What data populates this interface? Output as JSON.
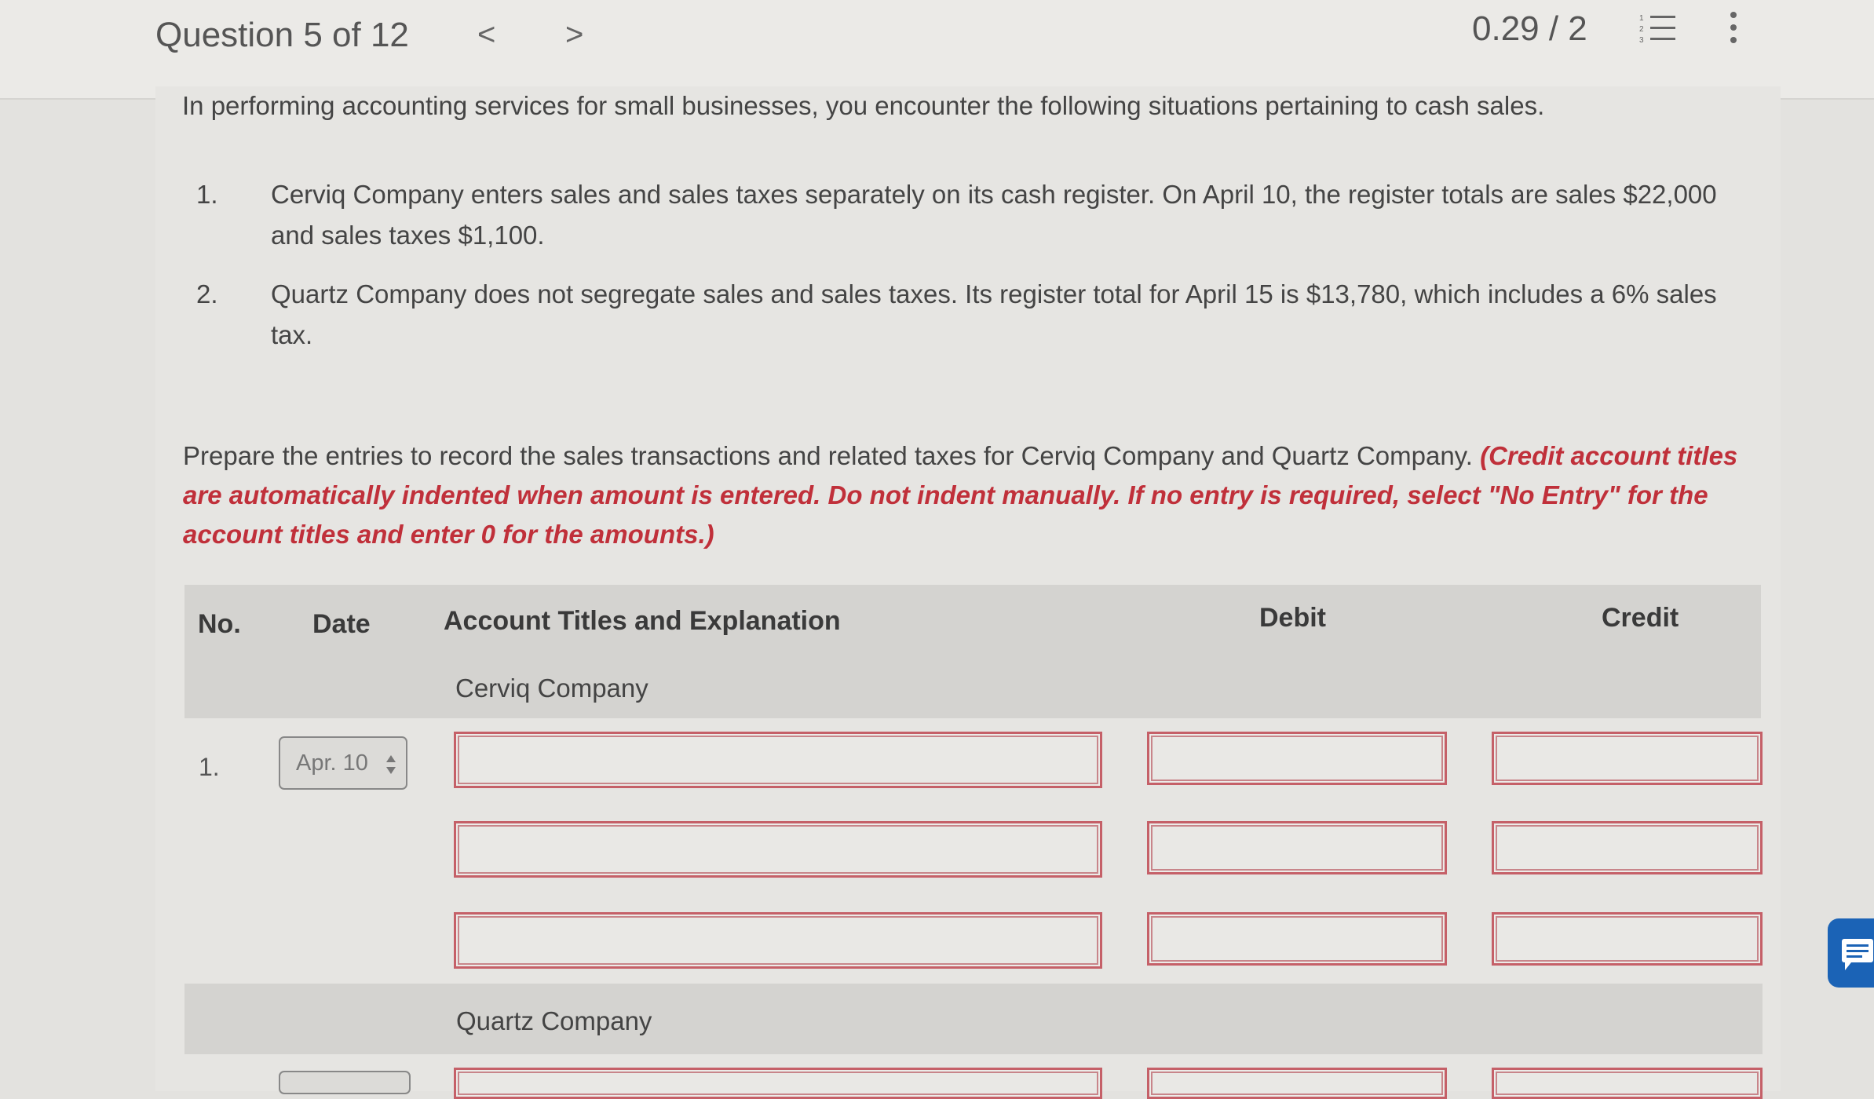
{
  "header": {
    "question_label": "Question 5 of 12",
    "prev_glyph": "<",
    "next_glyph": ">",
    "score": "0.29 / 2",
    "list_icon": "numbered-list-icon",
    "more_icon": "more-vertical-icon"
  },
  "problem": {
    "intro": "In performing accounting services for small businesses, you encounter the following situations pertaining to cash sales.",
    "items": [
      {
        "num": "1.",
        "text": "Cerviq Company enters sales and sales taxes separately on its cash register. On April 10, the register totals are sales $22,000 and sales taxes $1,100."
      },
      {
        "num": "2.",
        "text": "Quartz Company does not segregate sales and sales taxes. Its register total for April 15 is $13,780, which includes a 6% sales tax."
      }
    ],
    "instructions": "Prepare the entries to record the sales transactions and related taxes for Cerviq Company and Quartz Company.",
    "instructions_note": "(Credit account titles are automatically indented when amount is entered. Do not indent manually. If no entry is required, select \"No Entry\" for the account titles and enter 0 for the amounts.)"
  },
  "table": {
    "headers": {
      "no": "No.",
      "date": "Date",
      "account": "Account Titles and Explanation",
      "debit": "Debit",
      "credit": "Credit"
    },
    "sections": [
      {
        "company": "Cerviq Company",
        "row_no": "1.",
        "date": "Apr. 10"
      },
      {
        "company": "Quartz Company"
      }
    ]
  },
  "colors": {
    "accent_red": "#c0303a",
    "chat_blue": "#1b63b6"
  }
}
